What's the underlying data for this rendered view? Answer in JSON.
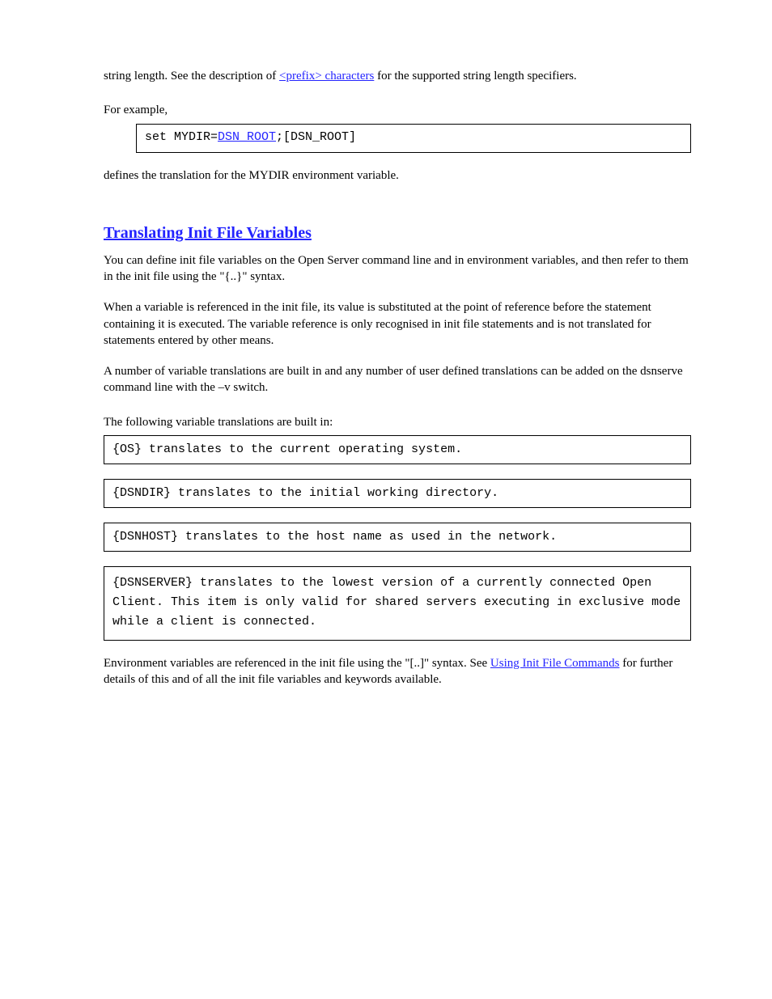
{
  "intro": {
    "lead": "string length. See the description of ",
    "link": "<prefix> characters",
    "trail": " for the supported string length specifiers."
  },
  "example": {
    "label": "For example,",
    "code_pre": "set MYDIR=",
    "code_link": "DSN_ROOT",
    "code_post": ";[DSN_ROOT]"
  },
  "conclusion": "defines the translation for the MYDIR environment variable.",
  "section_title": "Translating Init File Variables",
  "para1": "You can define init file variables on the Open Server command line and in environment variables, and then refer to them in the init file using the \"{..}\" syntax.",
  "para2": "When a variable is referenced in the init file, its value is substituted at the point of reference before the statement containing it is executed. The variable reference is only recognised in init file statements and is not translated for statements entered by other means.",
  "para3": "A number of variable translations are built in and any number of user defined translations can be added on the dsnserve command line with the –v switch.",
  "builtins": {
    "label": "The following variable translations are built in:",
    "items": [
      "{OS} translates to the current operating system.",
      "{DSNDIR} translates to the initial working directory.",
      "{DSNHOST} translates to the host name as used in the network.",
      "{DSNSERVER} translates to the lowest version of a currently connected Open Client. This item is only valid for shared servers executing in exclusive mode while a client is connected."
    ]
  },
  "endnote": {
    "pre": "Environment variables are referenced in the init file using the \"[..]\" syntax. See ",
    "link": "Using Init File Commands",
    "post": " for further details of this and of all the init file variables and keywords available."
  }
}
